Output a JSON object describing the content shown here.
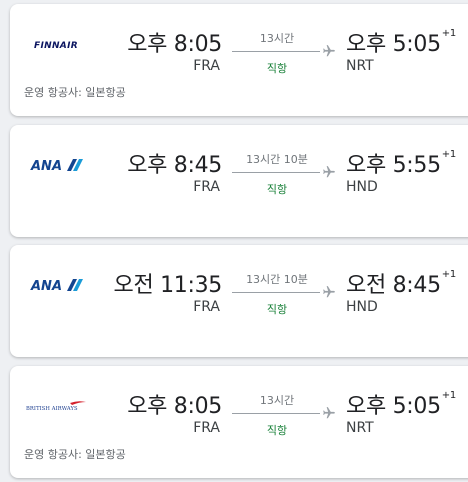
{
  "flights": [
    {
      "airline_logo": "finnair-logo",
      "logo_text": "FINNAIR",
      "departure_time": "오후 8:05",
      "departure_airport": "FRA",
      "duration": "13시간",
      "stops": "직항",
      "arrival_time": "오후 5:05",
      "arrival_day_offset": "+1",
      "arrival_airport": "NRT",
      "operator": "운영 항공사: 일본항공"
    },
    {
      "airline_logo": "ana-logo",
      "logo_text": "ANA",
      "departure_time": "오후 8:45",
      "departure_airport": "FRA",
      "duration": "13시간 10분",
      "stops": "직항",
      "arrival_time": "오후 5:55",
      "arrival_day_offset": "+1",
      "arrival_airport": "HND"
    },
    {
      "airline_logo": "ana-logo",
      "logo_text": "ANA",
      "departure_time": "오전 11:35",
      "departure_airport": "FRA",
      "duration": "13시간 10분",
      "stops": "직항",
      "arrival_time": "오전 8:45",
      "arrival_day_offset": "+1",
      "arrival_airport": "HND"
    },
    {
      "airline_logo": "british-airways-logo",
      "logo_text": "BRITISH AIRWAYS",
      "departure_time": "오후 8:05",
      "departure_airport": "FRA",
      "duration": "13시간",
      "stops": "직항",
      "arrival_time": "오후 5:05",
      "arrival_day_offset": "+1",
      "arrival_airport": "NRT",
      "operator": "운영 항공사: 일본항공"
    }
  ],
  "colors": {
    "nonstop": "#188038",
    "finnair_blue": "#0b1560",
    "ana_blue": "#13448f",
    "ana_light": "#1a9bd7",
    "ba_blue": "#1b3d8f",
    "ba_red": "#d4202c"
  }
}
